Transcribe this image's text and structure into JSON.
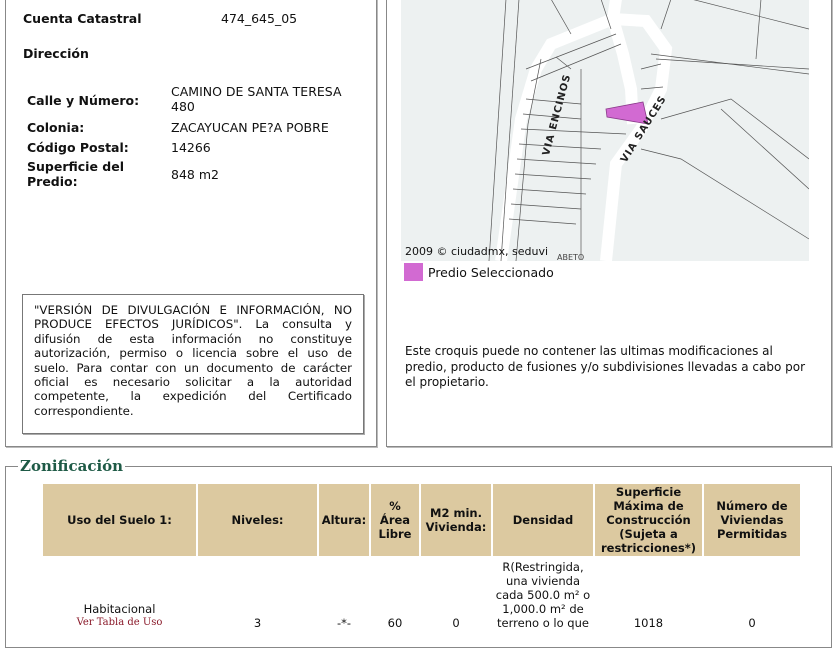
{
  "predio": {
    "cuenta_label": "Cuenta Catastral",
    "cuenta_value": "474_645_05",
    "direccion_label": "Dirección",
    "calle_label": "Calle y Número:",
    "calle_value_1": "CAMINO DE SANTA TERESA",
    "calle_value_2": "480",
    "colonia_label": "Colonia:",
    "colonia_value": "ZACAYUCAN PE?A POBRE",
    "cp_label": "Código Postal:",
    "cp_value": "14266",
    "superficie_label_1": "Superficie del",
    "superficie_label_2": "Predio:",
    "superficie_value": "848 m2"
  },
  "disclaimer": "\"VERSIÓN DE DIVULGACIÓN E INFORMACIÓN, NO PRODUCE EFECTOS JURÍDICOS\". La consulta y difusión de esta información no constituye autorización, permiso o licencia sobre el uso de suelo. Para contar con un documento de carácter oficial es necesario solicitar a la autoridad competente, la expedición del Certificado correspondiente.",
  "map": {
    "street_1": "VIA ENCINOS",
    "street_2": "VIA SAUCES",
    "street_3": "ABETO",
    "copyright": "2009 © ciudadmx, seduvi",
    "legend": "Predio Seleccionado",
    "legend_color": "#d26ad2"
  },
  "croquis_note": "Este croquis puede no contener las ultimas modificaciones al predio, producto de fusiones y/o subdivisiones llevadas a cabo por el propietario.",
  "zonificacion": {
    "title": "Zonificación",
    "headers": [
      "Uso del Suelo 1:",
      "Niveles:",
      "Altura:",
      "% Área Libre",
      "M2 min. Vivienda:",
      "Densidad",
      "Superficie Máxima de Construcción (Sujeta a restricciones*)",
      "Número de Viviendas Permitidas"
    ],
    "row": {
      "uso": "Habitacional",
      "uso_link": "Ver Tabla de Uso",
      "niveles": "3",
      "altura": "-*-",
      "area_libre": "60",
      "m2_min": "0",
      "densidad": "R(Restringida, una vivienda cada 500.0 m² o 1,000.0 m² de terreno o lo que",
      "superficie_max": "1018",
      "viviendas": "0"
    }
  }
}
